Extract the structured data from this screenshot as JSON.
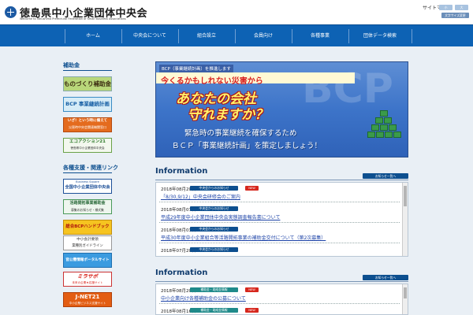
{
  "header": {
    "title": "徳島県中小企業団体中央会",
    "subtitle": "Welcome to Tokushima Prefectural Federation of Small Business Associations",
    "sitemap": "サイトマップ",
    "font_buttons": [
      "小",
      "大"
    ],
    "contrast_label": "文字サイズ変更"
  },
  "nav": [
    "ホーム",
    "中央会について",
    "組合設立",
    "会員向け",
    "各種事業",
    "団体データ検索"
  ],
  "sidebar": {
    "heading1": "補助金",
    "banners1": [
      {
        "text": "ものづくり補助金"
      },
      {
        "text": "BCP 事業継続計画"
      },
      {
        "text": "いざ！という時に備えて",
        "sub": "災害時中央会関連機関窓口"
      },
      {
        "text": "エコアクション21",
        "sub": "徳島県中小企業団体中央会"
      }
    ],
    "heading2": "各種支援・関連リンク",
    "banners2": [
      {
        "text": "全国中小企業団体中央会",
        "sub": "Business Square"
      },
      {
        "text": "活路開拓事業補助金",
        "sub": "募集のお知らせ・様式集"
      },
      {
        "text": "総合BCPハンドブック"
      },
      {
        "text": "中小会計要領",
        "sub": "業種別ガイドライン"
      },
      {
        "text": "官公需情報ポータルサイト"
      },
      {
        "text": "ミラサポ",
        "sub": "未来の企業★応援サイト"
      },
      {
        "text": "J-NET21",
        "sub": "中小企業ビジネス支援サイト"
      }
    ]
  },
  "hero": {
    "tag": "BCP（事業継続計画）を推進します",
    "red_line": "今くるかもしれない災害から",
    "big1": "あなたの会社",
    "big2": "守れますか？",
    "line1": "緊急時の事業継続を確保するため",
    "line2": "ＢＣＰ「事業継続計画」を策定しましょう！",
    "bg_text": "BCP"
  },
  "info1": {
    "title": "Information",
    "list_button": "お知らせ一覧へ",
    "rows": [
      {
        "date": "2018年08月20日",
        "category": "中央会からのお知らせ",
        "new": "NEW",
        "title": "「8/30,9/12」中央会研修会のご案内"
      },
      {
        "date": "2018年08月07日",
        "category": "中央会からのお知らせ",
        "new": "",
        "title": "平成29年度中小企業団体中央会実態調査報告書について"
      },
      {
        "date": "2018年08月03日",
        "category": "中央会からのお知らせ",
        "new": "",
        "title": "平成30年度中小企業組合等活路開拓事業の補助金交付について（第2次募集）"
      },
      {
        "date": "2018年07月20日",
        "category": "中央会からのお知らせ",
        "new": "",
        "title": ""
      }
    ]
  },
  "info2": {
    "title": "Information",
    "list_button": "お知らせ一覧へ",
    "rows": [
      {
        "date": "2018年08月20日",
        "category": "補助金・助成金情報",
        "new": "NEW",
        "title": "中小企業向け各種補助金の公募について"
      },
      {
        "date": "2018年08月16日",
        "category": "補助金・助成金情報",
        "new": "NEW",
        "title": ""
      }
    ]
  },
  "colors": {
    "nav": "#0d62b4",
    "accent": "#0d4f8f",
    "cat_teal": "#1f8a8a",
    "new_red": "#d6271d"
  }
}
